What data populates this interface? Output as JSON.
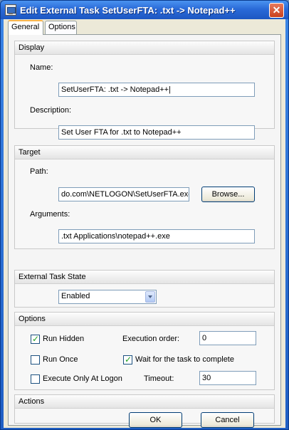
{
  "window": {
    "title": "Edit External Task SetUserFTA: .txt -> Notepad++",
    "close_glyph": "✕"
  },
  "tabs": [
    {
      "label": "General"
    },
    {
      "label": "Options"
    }
  ],
  "display": {
    "header": "Display",
    "name_label": "Name:",
    "name_value": "SetUserFTA: .txt -> Notepad++|",
    "description_label": "Description:",
    "description_value": "Set User FTA for .txt to Notepad++"
  },
  "target": {
    "header": "Target",
    "path_label": "Path:",
    "path_value": "do.com\\NETLOGON\\SetUserFTA.exe",
    "browse_label": "Browse...",
    "arguments_label": "Arguments:",
    "arguments_value": ".txt Applications\\notepad++.exe"
  },
  "state": {
    "header": "External Task State",
    "selected": "Enabled"
  },
  "options": {
    "header": "Options",
    "run_hidden": {
      "label": "Run Hidden",
      "checked": true
    },
    "run_once": {
      "label": "Run Once",
      "checked": false
    },
    "logon_only": {
      "label": "Execute Only At Logon",
      "checked": false
    },
    "wait": {
      "label": "Wait for the task to complete",
      "checked": true
    },
    "order_label": "Execution order:",
    "order_value": "0",
    "timeout_label": "Timeout:",
    "timeout_value": "30"
  },
  "actions": {
    "header": "Actions",
    "ok_label": "OK",
    "cancel_label": "Cancel"
  }
}
